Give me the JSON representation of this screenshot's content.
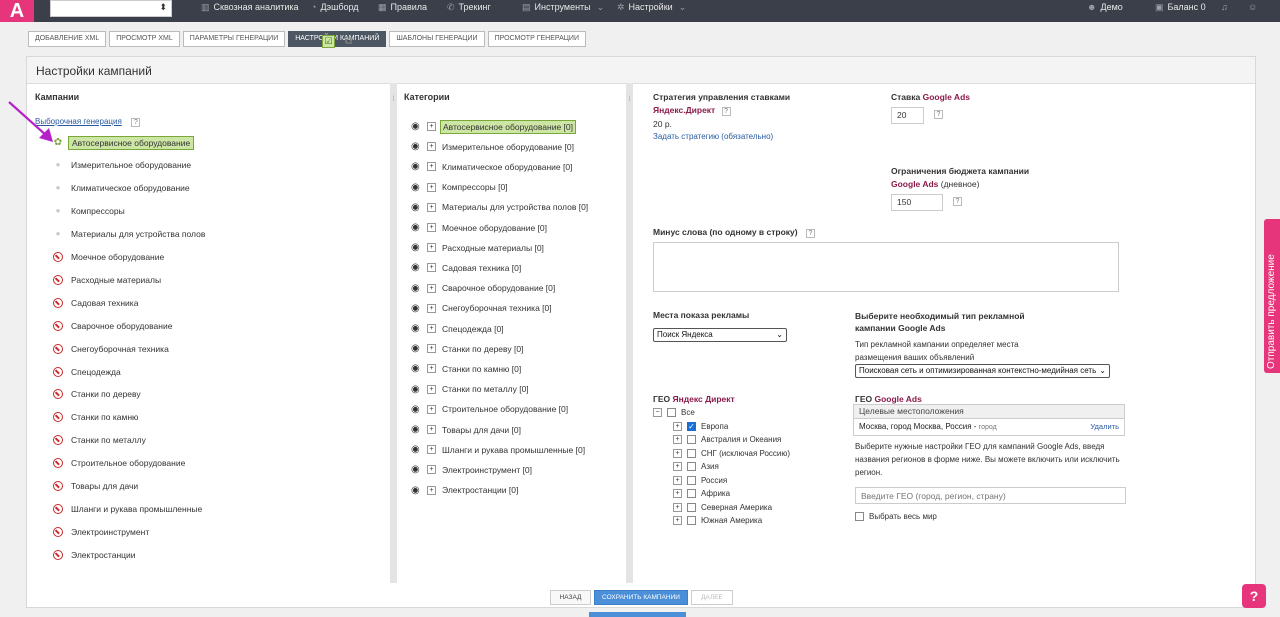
{
  "nav": {
    "logo": "A",
    "items": [
      {
        "label": "Сквозная аналитика",
        "icon": "bar-chart-icon",
        "glyph": "▥",
        "dropdown": false
      },
      {
        "label": "Дэшборд",
        "icon": "gauge-icon",
        "glyph": "◔",
        "dropdown": false
      },
      {
        "label": "Правила",
        "icon": "grid-icon",
        "glyph": "▦",
        "dropdown": false
      },
      {
        "label": "Трекинг",
        "icon": "phone-icon",
        "glyph": "✆",
        "dropdown": false
      },
      {
        "label": "Инструменты",
        "icon": "wrench-icon",
        "glyph": "▤",
        "dropdown": true
      },
      {
        "label": "Настройки",
        "icon": "gear-icon",
        "glyph": "✲",
        "dropdown": true
      },
      {
        "label": "Демо",
        "icon": "user-icon",
        "glyph": "☻",
        "dropdown": false
      },
      {
        "label": "Баланс 0",
        "icon": "wallet-icon",
        "glyph": "▣",
        "dropdown": false
      }
    ]
  },
  "steps": [
    "Добавление XML",
    "Просмотр XML",
    "Параметры генерации",
    "Настройки кампаний",
    "Шаблоны генерации",
    "Просмотр генерации"
  ],
  "active_step": 3,
  "page_title": "Настройки кампаний",
  "campaigns": {
    "title": "Кампании",
    "sample_link": "Выборочная генерация",
    "hint": "?",
    "items": [
      {
        "label": "Автосервисное оборудование",
        "status": "active",
        "selected": true
      },
      {
        "label": "Измерительное оборудование",
        "status": "pending"
      },
      {
        "label": "Климатическое оборудование",
        "status": "pending"
      },
      {
        "label": "Компрессоры",
        "status": "pending"
      },
      {
        "label": "Материалы для устройства полов",
        "status": "pending"
      },
      {
        "label": "Моечное оборудование",
        "status": "disabled"
      },
      {
        "label": "Расходные материалы",
        "status": "disabled"
      },
      {
        "label": "Садовая техника",
        "status": "disabled"
      },
      {
        "label": "Сварочное оборудование",
        "status": "disabled"
      },
      {
        "label": "Снегоуборочная техника",
        "status": "disabled"
      },
      {
        "label": "Спецодежда",
        "status": "disabled"
      },
      {
        "label": "Станки по дереву",
        "status": "disabled"
      },
      {
        "label": "Станки по камню",
        "status": "disabled"
      },
      {
        "label": "Станки по металлу",
        "status": "disabled"
      },
      {
        "label": "Строительное оборудование",
        "status": "disabled"
      },
      {
        "label": "Товары для дачи",
        "status": "disabled"
      },
      {
        "label": "Шланги и рукава промышленные",
        "status": "disabled"
      },
      {
        "label": "Электроинструмент",
        "status": "disabled"
      },
      {
        "label": "Электростанции",
        "status": "disabled"
      }
    ]
  },
  "categories": {
    "title": "Категории",
    "items": [
      "Автосервисное оборудование [0]",
      "Измерительное оборудование [0]",
      "Климатическое оборудование [0]",
      "Компрессоры [0]",
      "Материалы для устройства полов [0]",
      "Моечное оборудование [0]",
      "Расходные материалы [0]",
      "Садовая техника [0]",
      "Сварочное оборудование [0]",
      "Снегоуборочная техника [0]",
      "Спецодежда [0]",
      "Станки по дереву [0]",
      "Станки по камню [0]",
      "Станки по металлу [0]",
      "Строительное оборудование [0]",
      "Товары для дачи [0]",
      "Шланги и рукава промышленные [0]",
      "Электроинструмент [0]",
      "Электростанции [0]"
    ]
  },
  "settings": {
    "strategy_title": "Стратегия управления ставками",
    "strategy_brand": "Яндекс.Директ",
    "strategy_price": "20 р.",
    "strategy_link": "Задать стратегию (обязательно)",
    "bid_label": "Ставка ",
    "bid_brand": "Google Ads",
    "bid_value": "20",
    "budget_title": "Ограничения бюджета кампании",
    "budget_brand": "Google Ads",
    "budget_suffix": " (дневное)",
    "budget_value": "150",
    "minus_label": "Минус слова (по одному в строку)",
    "places_label": "Места показа рекламы",
    "places_value": "Поиск Яндекса",
    "gads_type_title": "Выберите необходимый тип рекламной кампании Google Ads",
    "gads_type_desc": "Тип рекламной кампании определяет места размещения ваших объявлений",
    "gads_type_value": "Поисковая сеть и оптимизированная контекстно-медийная сеть",
    "geo_yd_prefix": "ГЕО ",
    "geo_yd_brand": "Яндекс Директ",
    "geo_all": "Все",
    "geo_regions": [
      {
        "label": "Европа",
        "checked": true
      },
      {
        "label": "Австралия и Океания",
        "checked": false
      },
      {
        "label": "СНГ (исключая Россию)",
        "checked": false
      },
      {
        "label": "Азия",
        "checked": false
      },
      {
        "label": "Россия",
        "checked": false
      },
      {
        "label": "Африка",
        "checked": false
      },
      {
        "label": "Северная Америка",
        "checked": false
      },
      {
        "label": "Южная Америка",
        "checked": false
      }
    ],
    "geo_ga_prefix": "ГЕО ",
    "geo_ga_brand": "Google Ads",
    "geo_table_header": "Целевые местоположения",
    "geo_location": "Москва, город Москва, Россия - ",
    "geo_location_type": "город",
    "geo_delete": "Удалить",
    "geo_desc": "Выберите нужные настройки ГЕО для кампаний Google Ads, введя названия регионов в форме ниже. Вы можете включить или исключить регион.",
    "geo_input_placeholder": "Введите ГЕО (город, регион, страну)",
    "select_world": "Выбрать весь мир"
  },
  "footer": {
    "back": "Назад",
    "save": "Сохранить кампании",
    "next": "Далее"
  },
  "side_feedback": "Отправить предложение",
  "colors": {
    "brand_pink": "#e6357a",
    "nav_bg": "#3a3f4a",
    "selected_green": "#cde5a5",
    "disabled_red": "#c92a2a",
    "primary_blue": "#4a8fd8",
    "brand_text": "#8b1a4a"
  }
}
